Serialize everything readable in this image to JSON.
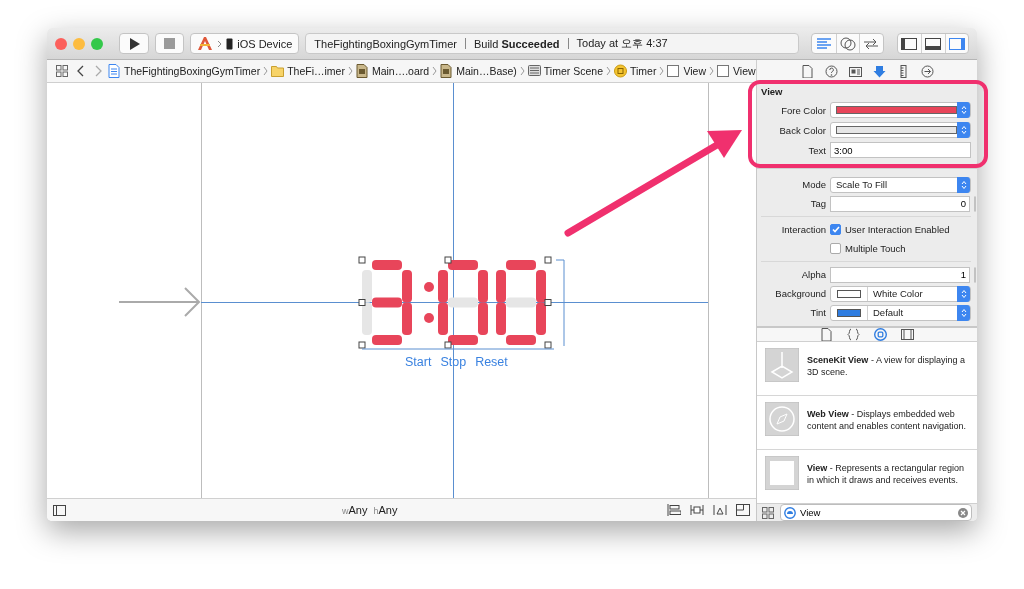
{
  "toolbar": {
    "scheme": "iOS Device",
    "activity": {
      "project": "TheFightingBoxingGymTimer",
      "status_prefix": "Build",
      "status": "Succeeded",
      "time": "Today at 오후 4:37"
    }
  },
  "breadcrumb": [
    {
      "kind": "project",
      "label": "TheFightingBoxingGymTimer"
    },
    {
      "kind": "folder",
      "label": "TheFi…imer"
    },
    {
      "kind": "storyboard",
      "label": "Main….oard"
    },
    {
      "kind": "storyboard",
      "label": "Main…Base)"
    },
    {
      "kind": "scene",
      "label": "Timer Scene"
    },
    {
      "kind": "controller",
      "label": "Timer"
    },
    {
      "kind": "view",
      "label": "View"
    },
    {
      "kind": "view",
      "label": "View"
    }
  ],
  "inspector_tabs": [
    {
      "kind": "file",
      "selected": false
    },
    {
      "kind": "help",
      "selected": false
    },
    {
      "kind": "identity",
      "selected": false
    },
    {
      "kind": "attributes",
      "selected": true
    },
    {
      "kind": "size",
      "selected": false
    },
    {
      "kind": "connections",
      "selected": false
    }
  ],
  "custom_section": {
    "title": "View",
    "fields": [
      {
        "kind": "color",
        "label": "Fore Color",
        "color": "#e8455a"
      },
      {
        "kind": "color",
        "label": "Back Color",
        "color": "#e6e6e6"
      },
      {
        "kind": "text",
        "label": "Text",
        "value": "3:00"
      }
    ]
  },
  "view_section": {
    "rows": [
      {
        "kind": "dropdown",
        "label": "Mode",
        "value": "Scale To Fill"
      },
      {
        "kind": "stepper",
        "label": "Tag",
        "value": "0"
      },
      {
        "kind": "checkbox",
        "label": "Interaction",
        "text": "User Interaction Enabled",
        "checked": true
      },
      {
        "kind": "checkbox",
        "text": "Multiple Touch",
        "checked": false
      },
      {
        "kind": "stepper",
        "label": "Alpha",
        "value": "1"
      },
      {
        "kind": "color",
        "label": "Background",
        "color": "#ffffff",
        "value": "White Color"
      },
      {
        "kind": "color",
        "label": "Tint",
        "color": "#2f7de1",
        "value": "Default"
      }
    ]
  },
  "library_tabs": [
    {
      "kind": "file",
      "selected": false
    },
    {
      "kind": "code",
      "selected": false
    },
    {
      "kind": "object",
      "selected": true
    },
    {
      "kind": "media",
      "selected": false
    }
  ],
  "library_items": [
    {
      "kind": "scenekit",
      "title": "SceneKit View",
      "description": " - A view for displaying a 3D scene."
    },
    {
      "kind": "web",
      "title": "Web View",
      "description": " - Displays embedded web content and enables content navigation."
    },
    {
      "kind": "view",
      "title": "View",
      "description": " - Represents a rectangular region in which it draws and receives events."
    }
  ],
  "library_filter": {
    "value": "View"
  },
  "canvas": {
    "buttons": [
      "Start",
      "Stop",
      "Reset"
    ]
  },
  "bottom_bar": {
    "width_prefix": "w",
    "width": "Any",
    "height_prefix": "h",
    "height": "Any"
  }
}
